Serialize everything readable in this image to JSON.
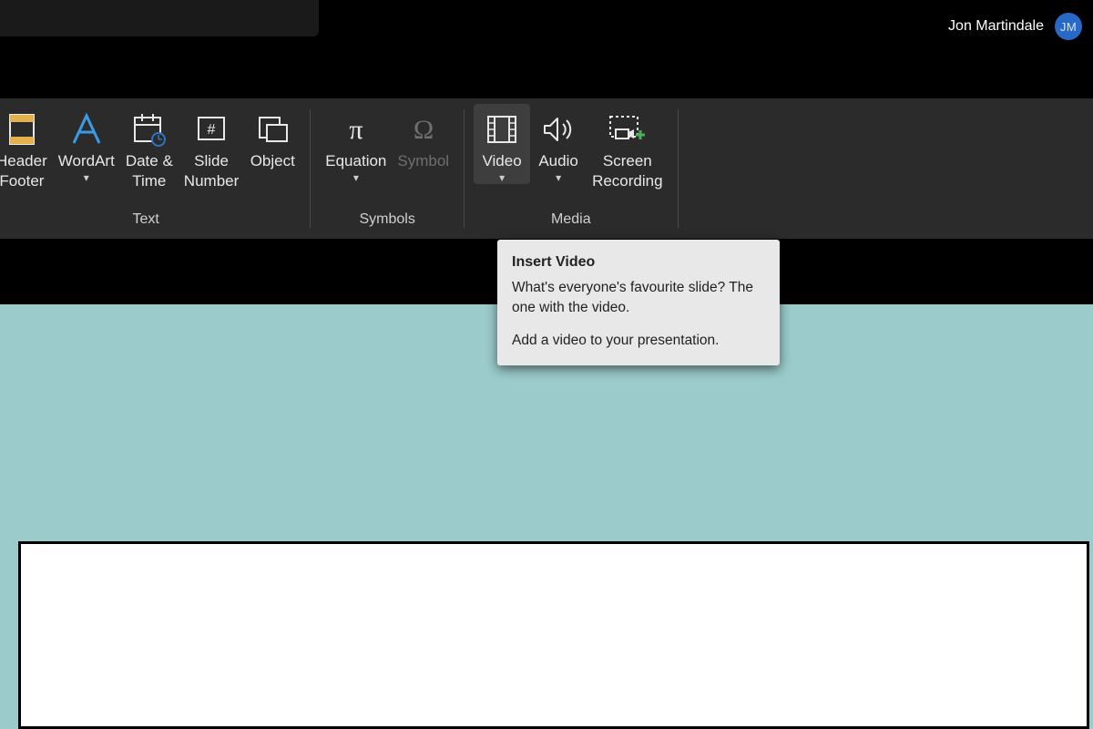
{
  "user": {
    "name": "Jon Martindale",
    "initials": "JM"
  },
  "ribbon": {
    "groups": {
      "text": {
        "label": "Text"
      },
      "symbols": {
        "label": "Symbols"
      },
      "media": {
        "label": "Media"
      }
    },
    "commands": {
      "headerFooter": {
        "label": "Header\nFooter"
      },
      "wordArt": {
        "label": "WordArt"
      },
      "dateTime": {
        "label": "Date &\nTime"
      },
      "slideNumber": {
        "label": "Slide\nNumber"
      },
      "object": {
        "label": "Object"
      },
      "equation": {
        "label": "Equation"
      },
      "symbol": {
        "label": "Symbol"
      },
      "video": {
        "label": "Video"
      },
      "audio": {
        "label": "Audio"
      },
      "screenRec": {
        "label": "Screen\nRecording"
      }
    }
  },
  "tooltip": {
    "title": "Insert Video",
    "line1": "What's everyone's favourite slide? The one with the video.",
    "line2": "Add a video to your presentation."
  }
}
